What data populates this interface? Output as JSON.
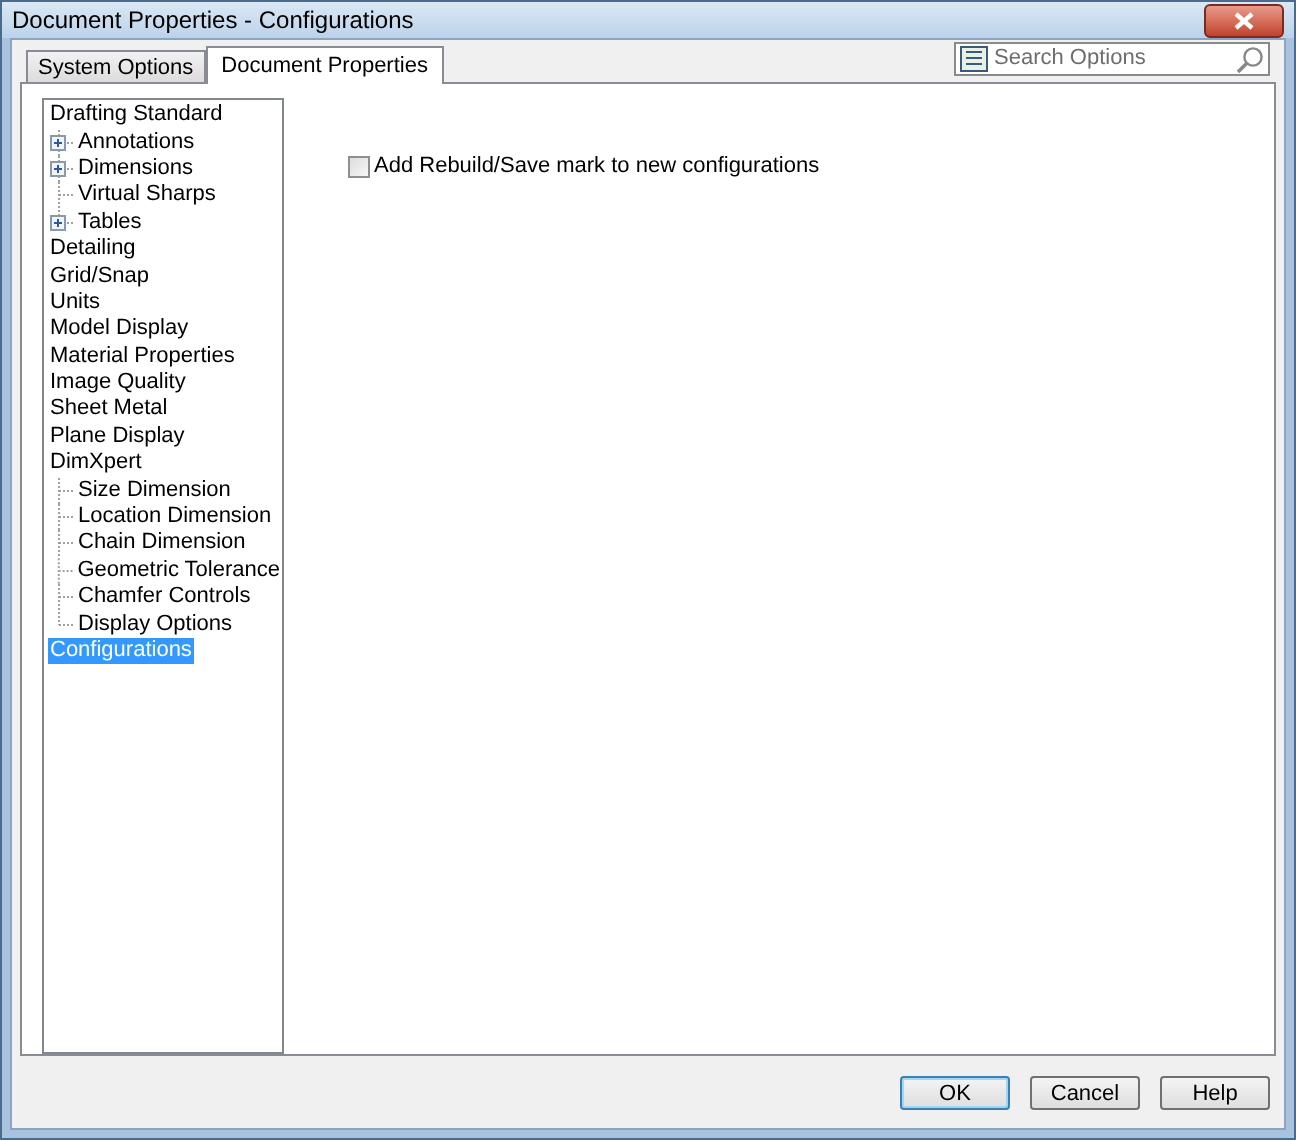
{
  "window": {
    "title": "Document Properties - Configurations"
  },
  "tabs": [
    {
      "label": "System Options",
      "selected": false
    },
    {
      "label": "Document Properties",
      "selected": true
    }
  ],
  "search": {
    "placeholder": "Search Options"
  },
  "tree": [
    {
      "label": "Drafting Standard",
      "selected": false,
      "children": [
        {
          "label": "Annotations",
          "kind": "expandable",
          "selected": false
        },
        {
          "label": "Dimensions",
          "kind": "expandable",
          "selected": false
        },
        {
          "label": "Virtual Sharps",
          "kind": "leaf",
          "selected": false
        },
        {
          "label": "Tables",
          "kind": "expandable",
          "selected": false
        }
      ]
    },
    {
      "label": "Detailing",
      "selected": false
    },
    {
      "label": "Grid/Snap",
      "selected": false
    },
    {
      "label": "Units",
      "selected": false
    },
    {
      "label": "Model Display",
      "selected": false
    },
    {
      "label": "Material Properties",
      "selected": false
    },
    {
      "label": "Image Quality",
      "selected": false
    },
    {
      "label": "Sheet Metal",
      "selected": false
    },
    {
      "label": "Plane Display",
      "selected": false
    },
    {
      "label": "DimXpert",
      "selected": false,
      "children": [
        {
          "label": "Size Dimension",
          "kind": "leaf",
          "selected": false
        },
        {
          "label": "Location Dimension",
          "kind": "leaf",
          "selected": false
        },
        {
          "label": "Chain Dimension",
          "kind": "leaf",
          "selected": false
        },
        {
          "label": "Geometric Tolerance",
          "kind": "leaf",
          "selected": false
        },
        {
          "label": "Chamfer Controls",
          "kind": "leaf",
          "selected": false
        },
        {
          "label": "Display Options",
          "kind": "leaf",
          "selected": false
        }
      ]
    },
    {
      "label": "Configurations",
      "selected": true
    }
  ],
  "options": [
    {
      "label": "Add Rebuild/Save mark to new configurations",
      "checked": false
    }
  ],
  "buttons": [
    {
      "label": "OK",
      "default": true
    },
    {
      "label": "Cancel",
      "default": false
    },
    {
      "label": "Help",
      "default": false
    }
  ]
}
